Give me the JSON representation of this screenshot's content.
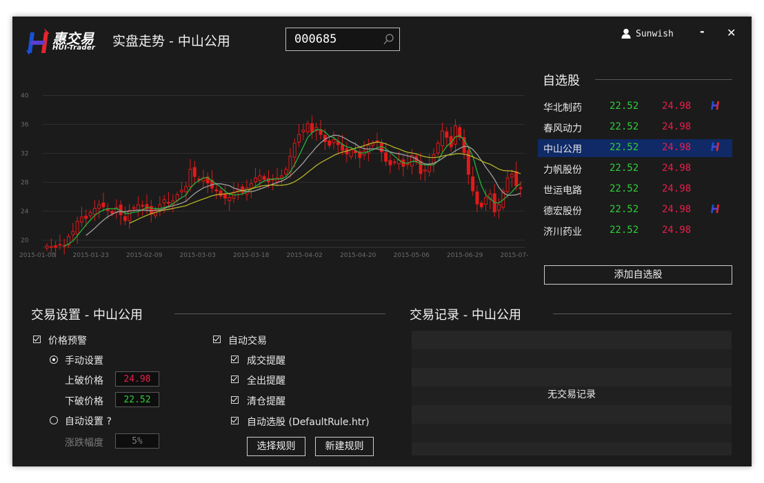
{
  "app": {
    "logo_text": "惠交易",
    "logo_sub": "HUI-Trader",
    "title": "实盘走势 - 中山公用",
    "user": "Sunwish",
    "minimize": "-",
    "close": "✕"
  },
  "search": {
    "value": "000685"
  },
  "chart_data": {
    "type": "candlestick",
    "y_ticks": [
      "40",
      "36",
      "32",
      "28",
      "24",
      "20"
    ],
    "ylim": [
      19,
      41
    ],
    "x_ticks": [
      "2015-01-08",
      "2015-01-23",
      "2015-02-09",
      "2015-03-03",
      "2015-03-18",
      "2015-04-02",
      "2015-04-20",
      "2015-05-06",
      "2015-06-29",
      "2015-07-"
    ],
    "close": [
      19.2,
      19.1,
      19.0,
      19.4,
      19.3,
      20.5,
      21.2,
      22.6,
      23.2,
      23.0,
      23.8,
      24.4,
      24.9,
      24.6,
      24.1,
      23.7,
      24.5,
      23.5,
      22.7,
      24.1,
      24.5,
      24.9,
      24.8,
      24.3,
      23.6,
      24.2,
      24.9,
      25.6,
      25.1,
      25.4,
      26.3,
      26.9,
      27.4,
      29.8,
      28.8,
      28.3,
      28.6,
      27.9,
      27.2,
      26.8,
      26.1,
      25.8,
      25.9,
      26.6,
      27.0,
      26.6,
      27.2,
      27.8,
      28.6,
      28.9,
      28.4,
      28.1,
      28.3,
      28.6,
      28.9,
      29.8,
      31.6,
      33.4,
      34.6,
      35.2,
      36.1,
      34.9,
      35.6,
      34.6,
      33.6,
      33.1,
      33.9,
      33.2,
      32.4,
      31.9,
      32.5,
      32.1,
      31.4,
      32.3,
      33.1,
      33.4,
      33.7,
      32.2,
      30.9,
      30.4,
      30.8,
      31.1,
      30.2,
      30.6,
      31.7,
      30.8,
      29.2,
      29.7,
      30.5,
      31.8,
      33.4,
      35.1,
      34.2,
      32.9,
      35.8,
      34.2,
      32.1,
      29.1,
      26.8,
      25.0,
      24.6,
      25.9,
      26.4,
      23.9,
      24.9,
      26.8,
      28.6,
      29.1,
      27.5,
      27.1
    ],
    "ma_series": [
      {
        "color": "#22b43a"
      },
      {
        "color": "#a0a0a0"
      },
      {
        "color": "#b5b52a"
      }
    ]
  },
  "watchlist": {
    "title": "自选股",
    "items": [
      {
        "name": "华北制药",
        "buy": "22.52",
        "sell": "24.98",
        "logo": true,
        "selected": false
      },
      {
        "name": "春风动力",
        "buy": "22.52",
        "sell": "24.98",
        "logo": false,
        "selected": false
      },
      {
        "name": "中山公用",
        "buy": "22.52",
        "sell": "24.98",
        "logo": true,
        "selected": true
      },
      {
        "name": "力帆股份",
        "buy": "22.52",
        "sell": "24.98",
        "logo": false,
        "selected": false
      },
      {
        "name": "世运电路",
        "buy": "22.52",
        "sell": "24.98",
        "logo": false,
        "selected": false
      },
      {
        "name": "德宏股份",
        "buy": "22.52",
        "sell": "24.98",
        "logo": true,
        "selected": false
      },
      {
        "name": "济川药业",
        "buy": "22.52",
        "sell": "24.98",
        "logo": false,
        "selected": false
      }
    ],
    "add_button": "添加自选股"
  },
  "settings": {
    "title": "交易设置 - 中山公用",
    "price_alert": "价格预警",
    "manual": "手动设置",
    "upper_label": "上破价格",
    "upper_value": "24.98",
    "lower_label": "下破价格",
    "lower_value": "22.52",
    "auto": "自动设置 ?",
    "range_label": "涨跌幅度",
    "range_value": "5%",
    "auto_trade": "自动交易",
    "deal_alert": "成交提醒",
    "all_out_alert": "全出提醒",
    "clear_alert": "清仓提醒",
    "auto_select": "自动选股 (DefaultRule.htr)",
    "select_rule": "选择规则",
    "new_rule": "新建规则"
  },
  "records": {
    "title": "交易记录 - 中山公用",
    "empty": "无交易记录"
  }
}
